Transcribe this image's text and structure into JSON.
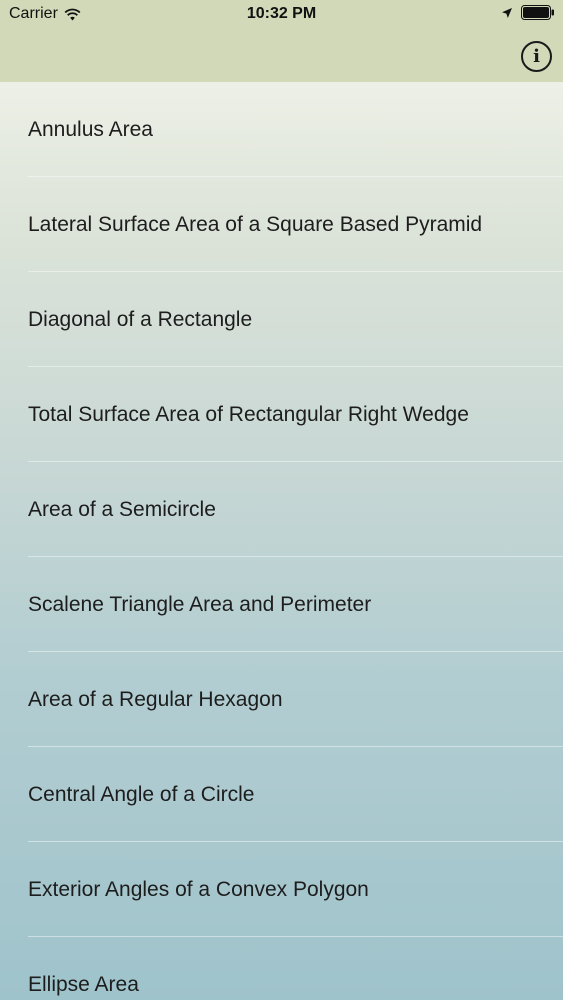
{
  "status_bar": {
    "carrier": "Carrier",
    "time": "10:32 PM"
  },
  "nav": {
    "info_icon": "info-circle-icon",
    "info_glyph": "i"
  },
  "list": {
    "items": [
      {
        "label": "Annulus Area"
      },
      {
        "label": "Lateral Surface Area of a Square Based Pyramid"
      },
      {
        "label": "Diagonal of a Rectangle"
      },
      {
        "label": "Total Surface Area of Rectangular Right Wedge"
      },
      {
        "label": "Area of a Semicircle"
      },
      {
        "label": "Scalene Triangle Area and Perimeter"
      },
      {
        "label": "Area of a Regular Hexagon"
      },
      {
        "label": "Central Angle of a Circle"
      },
      {
        "label": "Exterior Angles of a Convex Polygon"
      },
      {
        "label": "Ellipse Area"
      }
    ]
  },
  "colors": {
    "header_bg": "#d1d9b9",
    "list_top": "#edf0e6",
    "list_bottom": "#9fc3cb",
    "text": "#1d1d1d"
  }
}
